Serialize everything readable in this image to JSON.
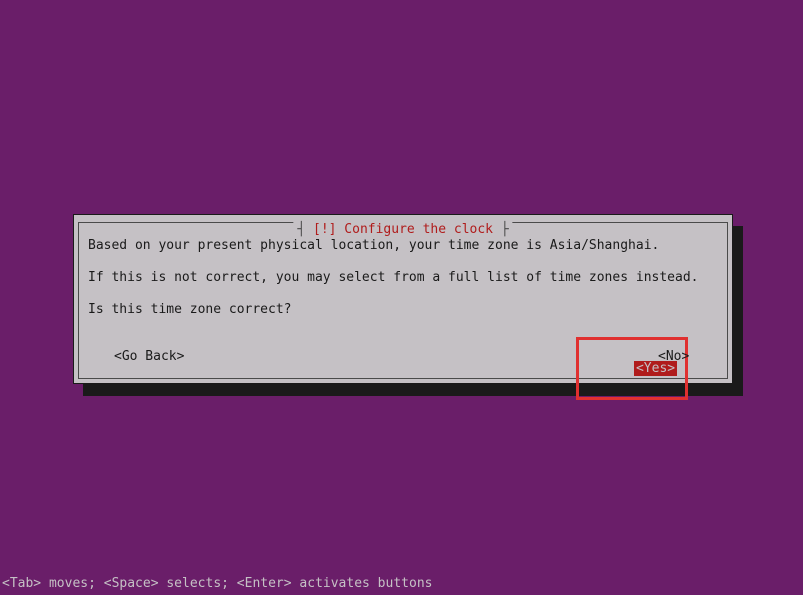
{
  "dialog": {
    "title": "[!] Configure the clock",
    "line1": "Based on your present physical location, your time zone is Asia/Shanghai.",
    "line2": "If this is not correct, you may select from a full list of time zones instead.",
    "line3": "Is this time zone correct?",
    "buttons": {
      "goback": "<Go Back>",
      "yes": "<Yes>",
      "no": "<No>"
    }
  },
  "footer": "<Tab> moves; <Space> selects; <Enter> activates buttons"
}
